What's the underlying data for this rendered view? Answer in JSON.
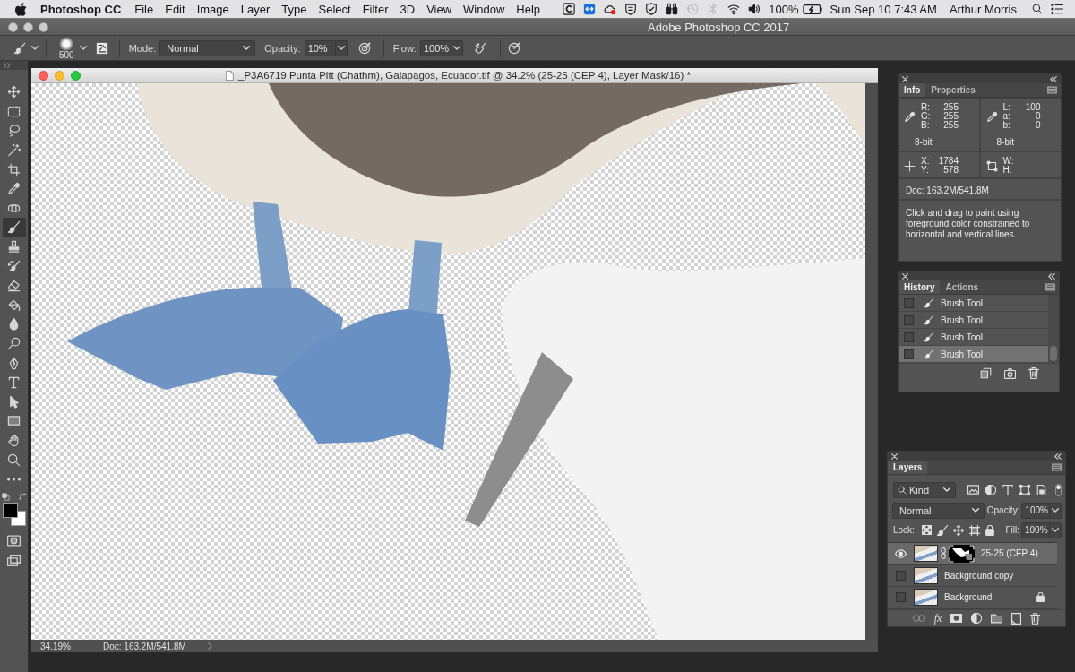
{
  "menu_bar": {
    "app_name": "Photoshop CC",
    "menus": [
      "File",
      "Edit",
      "Image",
      "Layer",
      "Type",
      "Select",
      "Filter",
      "3D",
      "View",
      "Window",
      "Help"
    ],
    "status_icons": [
      {
        "kind": "letter-c",
        "disabled": false
      },
      {
        "kind": "remote",
        "disabled": false
      },
      {
        "kind": "cloud",
        "disabled": false
      },
      {
        "kind": "shield",
        "disabled": false
      },
      {
        "kind": "shield-check",
        "disabled": false
      },
      {
        "kind": "binoculars",
        "disabled": false
      },
      {
        "kind": "history-clock",
        "disabled": true
      },
      {
        "kind": "bluetooth",
        "disabled": true
      },
      {
        "kind": "wifi",
        "disabled": false
      },
      {
        "kind": "volume",
        "disabled": false
      }
    ],
    "battery": "100%",
    "clock": "Sun Sep 10 7:43 AM",
    "user": "Arthur Morris"
  },
  "app_window": {
    "title": "Adobe Photoshop CC 2017"
  },
  "options_bar": {
    "brush_size": "500",
    "mode": {
      "label": "Mode:",
      "value": "Normal"
    },
    "opacity": {
      "label": "Opacity:",
      "value": "10%"
    },
    "flow": {
      "label": "Flow:",
      "value": "100%"
    }
  },
  "toolbar": {
    "tools": [
      {
        "kind": "move",
        "selected": false
      },
      {
        "kind": "marquee",
        "selected": false
      },
      {
        "kind": "lasso",
        "selected": false
      },
      {
        "kind": "magic-wand",
        "selected": false
      },
      {
        "kind": "crop",
        "selected": false
      },
      {
        "kind": "eyedropper",
        "selected": false
      },
      {
        "kind": "healing",
        "selected": false
      },
      {
        "kind": "brush",
        "selected": true
      },
      {
        "kind": "stamp",
        "selected": false
      },
      {
        "kind": "history-brush",
        "selected": false
      },
      {
        "kind": "eraser",
        "selected": false
      },
      {
        "kind": "bucket",
        "selected": false
      },
      {
        "kind": "blur",
        "selected": false
      },
      {
        "kind": "dodge",
        "selected": false
      },
      {
        "kind": "pen",
        "selected": false
      },
      {
        "kind": "type",
        "selected": false
      },
      {
        "kind": "path-select",
        "selected": false
      },
      {
        "kind": "rectangle",
        "selected": false
      },
      {
        "kind": "hand",
        "selected": false
      },
      {
        "kind": "zoom",
        "selected": false
      },
      {
        "kind": "more",
        "selected": false
      }
    ],
    "swatches": [
      {
        "kind": "foreground",
        "color": "#000000"
      },
      {
        "kind": "background",
        "color": "#ffffff"
      }
    ]
  },
  "document": {
    "title": "_P3A6719 Punta Pitt (Chathm), Galapagos, Ecuador.tif @ 34.2% (25-25 (CEP 4), Layer Mask/16) *",
    "zoom": "34.19%",
    "doc_size": "Doc: 163.2M/541.8M"
  },
  "info_panel": {
    "tabs": [
      {
        "label": "Info",
        "selected": true
      },
      {
        "label": "Properties",
        "selected": false
      }
    ],
    "rgb": [
      {
        "label": "R:",
        "value": "255"
      },
      {
        "label": "G:",
        "value": "255"
      },
      {
        "label": "B:",
        "value": "255"
      }
    ],
    "rgb_depth": "8-bit",
    "lab": [
      {
        "label": "L:",
        "value": "100"
      },
      {
        "label": "a:",
        "value": "0"
      },
      {
        "label": "b:",
        "value": "0"
      }
    ],
    "lab_depth": "8-bit",
    "position": [
      {
        "label": "X:",
        "value": "1784"
      },
      {
        "label": "Y:",
        "value": "578"
      }
    ],
    "size": [
      {
        "label": "W:"
      },
      {
        "label": "H:"
      }
    ],
    "doc_size": "Doc: 163.2M/541.8M",
    "hint": "Click and drag to paint using foreground color constrained to horizontal and vertical lines."
  },
  "history_panel": {
    "tabs": [
      {
        "label": "History",
        "selected": true
      },
      {
        "label": "Actions",
        "selected": false
      }
    ],
    "states": [
      {
        "label": "Brush Tool",
        "checked": false,
        "selected": false
      },
      {
        "label": "Brush Tool",
        "checked": false,
        "selected": false
      },
      {
        "label": "Brush Tool",
        "checked": false,
        "selected": false
      },
      {
        "label": "Brush Tool",
        "checked": false,
        "selected": true
      }
    ]
  },
  "layers_panel": {
    "tabs": [
      {
        "label": "Layers",
        "selected": true
      }
    ],
    "filter": "Kind",
    "filter_enabled": true,
    "blend_mode": "Normal",
    "opacity": {
      "label": "Opacity:",
      "value": "100%"
    },
    "lock_label": "Lock:",
    "fill": {
      "label": "Fill:",
      "value": "100%"
    },
    "layers": [
      {
        "name": "25-25 (CEP 4)",
        "visible": true,
        "selected": true,
        "mask": true,
        "locked": false
      },
      {
        "name": "Background copy",
        "visible": false,
        "selected": false,
        "mask": false,
        "locked": false
      },
      {
        "name": "Background",
        "visible": false,
        "selected": false,
        "mask": false,
        "locked": true
      }
    ],
    "effects_label": "fx"
  }
}
